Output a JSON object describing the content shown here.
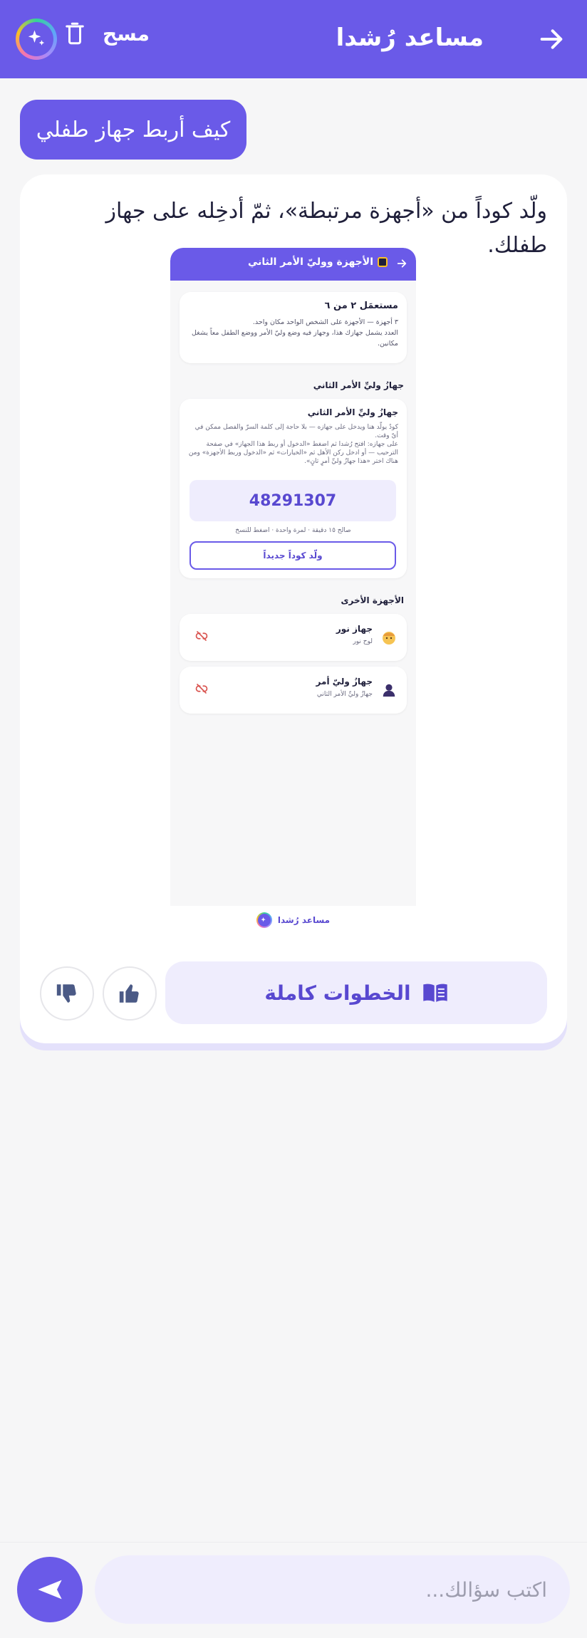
{
  "header": {
    "title": "مساعد رُشدا",
    "clear_label": "مسح"
  },
  "chat": {
    "user_message": "كيف أربط جهاز طفلي",
    "bot_message": "ولّد كوداً من «أجهزة مرتبطة»، ثمّ أدخِله على جهاز طفلك."
  },
  "preview": {
    "header_title": "الأجهزة ووليّ الأمر الثاني",
    "usage_card": {
      "title": "مستعمَل ٢ من ٦",
      "line1": "٣ أجهزة — الأجهزة على الشخص الواحد مكان واحد.",
      "line2": "العدد يشمل جهازك هذا، وجهاز فيه وضع وليّ الأمر ووضع الطفل معاً يشغل مكانين."
    },
    "section_second_parent": "جهازُ وليِّ الأمر الثاني",
    "parent_card": {
      "title": "جهازُ وليِّ الأمر الثاني",
      "desc1": "كودٌ يولّد هنا ويدخل على جهازه — بلا حاجة إلى كلمة السرّ والفصل ممكن في أيّ وقت.",
      "desc2": "على جهازه: افتح رُشدا ثم اضغط «الدخول أو ربط هذا الجهاز» في صفحة الترحيب — أو ادخل ركن الأهل ثم «الخيارات» ثم «الدخول وربط الأجهزة» ومن هناك اختر «هذا جهازُ وليِّ أمرٍ ثانٍ».",
      "code": "48291307",
      "validity": "صالح ١٥ دقيقة · لمرة واحدة · اضغط للنسخ",
      "generate_label": "ولّد كوداً جديداً"
    },
    "section_other_devices": "الأجهزة الأخرى",
    "devices": [
      {
        "name": "جهاز نور",
        "subtitle": "لوح نور",
        "avatar": "child-avatar-icon"
      },
      {
        "name": "جهازُ وليّ أمر",
        "subtitle": "جهازُ وليِّ الأمر الثاني",
        "avatar": "parent-avatar-icon"
      }
    ],
    "footer_label": "مساعد رُشدا"
  },
  "actions": {
    "full_steps_label": "الخطوات كاملة"
  },
  "composer": {
    "placeholder": "اكتب سؤالك..."
  },
  "colors": {
    "brand": "#6a5ae8",
    "soft": "#efedfd",
    "danger": "#d9534f"
  }
}
